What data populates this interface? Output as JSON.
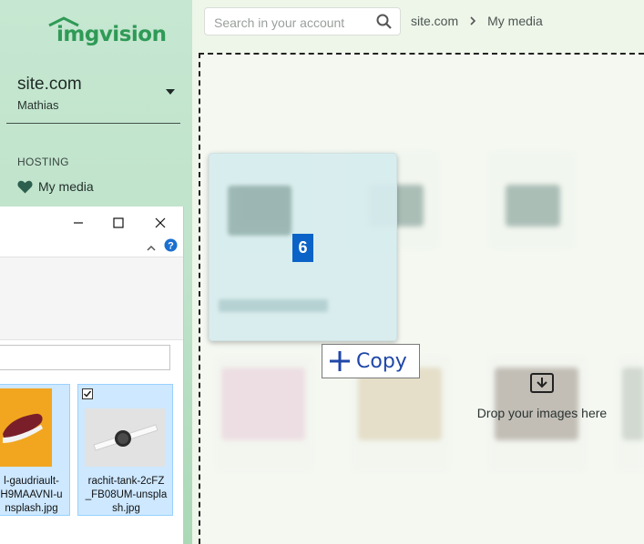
{
  "sidebar": {
    "logo_text": "imgvision",
    "site_name": "site.com",
    "user_name": "Mathias",
    "section_label": "HOSTING",
    "nav_items": [
      {
        "label": "My media",
        "icon": "heart-icon"
      }
    ]
  },
  "header": {
    "search_placeholder": "Search in your account",
    "breadcrumb": [
      "site.com",
      "My media"
    ]
  },
  "main": {
    "drop_hint": "Drop your images here",
    "drag": {
      "count": "6",
      "action_label": "Copy"
    }
  },
  "explorer": {
    "files": [
      {
        "name_lines": [
          "l-gaudriault-",
          "H9MAAVNI-u",
          "nsplash.jpg"
        ],
        "selected": true,
        "checked": false
      },
      {
        "name_lines": [
          "rachit-tank-2cFZ",
          "_FB08UM-unspla",
          "sh.jpg"
        ],
        "selected": true,
        "checked": true
      }
    ]
  },
  "colors": {
    "brand_green": "#2f9a56",
    "badge_blue": "#0b63c7",
    "copy_blue": "#1f47a8",
    "selection_blue": "#cde8ff"
  }
}
